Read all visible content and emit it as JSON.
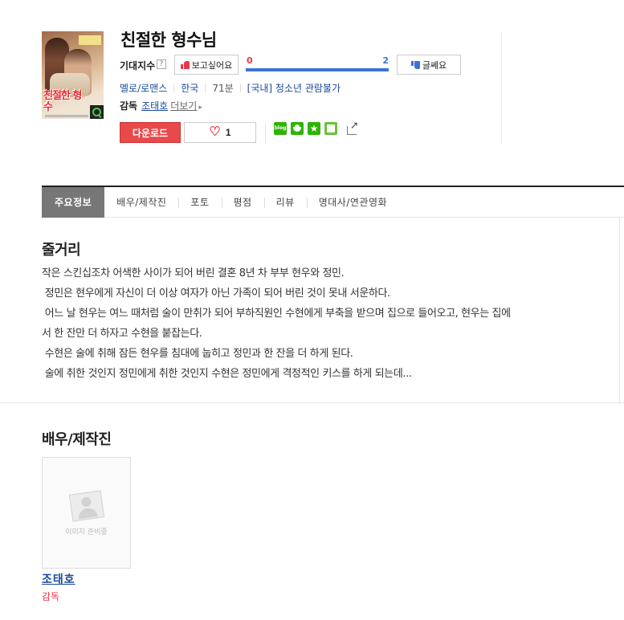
{
  "movie": {
    "title": "친절한 형수님",
    "poster": {
      "title_text": "친절한 형수",
      "tagline_text": ""
    },
    "expectation": {
      "label": "기대지수",
      "help_icon": "question-icon",
      "want_label": "보고싶어요",
      "nope_label": "글쎄요",
      "want_count": "0",
      "nope_count": "2",
      "want_fraction": 0,
      "nope_fraction": 1,
      "want_color": "#e8394a",
      "nope_color": "#3b73d4"
    },
    "meta": {
      "genre": "멜로/로맨스",
      "country": "한국",
      "runtime": "71분",
      "rating": "[국내] 청소년 관람불가"
    },
    "director": {
      "label": "감독",
      "name": "조태호",
      "more": "더보기"
    },
    "actions": {
      "download_label": "다운로드",
      "like_count": "1",
      "accent_color": "#e8494a"
    },
    "share": {
      "blog_text": "blog",
      "icons": [
        "blog-icon",
        "cafe-icon",
        "bookmark-star-icon",
        "band-icon",
        "share-icon"
      ]
    }
  },
  "tabs": [
    {
      "label": "주요정보",
      "active": true
    },
    {
      "label": "배우/제작진",
      "active": false
    },
    {
      "label": "포토",
      "active": false
    },
    {
      "label": "평점",
      "active": false
    },
    {
      "label": "리뷰",
      "active": false
    },
    {
      "label": "명대사/연관영화",
      "active": false
    }
  ],
  "synopsis": {
    "heading": "줄거리",
    "lines": [
      "작은 스킨십조차 어색한 사이가 되어 버린 결혼 8년 차 부부 현우와 정민.",
      " 정민은 현우에게 자신이 더 이상 여자가 아닌 가족이 되어 버린 것이 못내 서운하다.",
      " 어느 날 현우는 여느 때처럼 술이 만취가 되어 부하직원인 수현에게 부축을 받으며 집으로 들어오고, 현우는 집에",
      "서 한 잔만 더 하자고 수현을 붙잡는다.",
      " 수현은 술에 취해 잠든 현우를 침대에 눕히고 정민과 한 잔을 더 하게 된다.",
      " 술에 취한 것인지 정민에게 취한 것인지 수현은 정민에게 격정적인 키스를 하게 되는데..."
    ]
  },
  "cast": {
    "heading": "배우/제작진",
    "members": [
      {
        "name": "조태호",
        "role": "감독",
        "photo_placeholder": "이미지 준비중"
      }
    ]
  }
}
